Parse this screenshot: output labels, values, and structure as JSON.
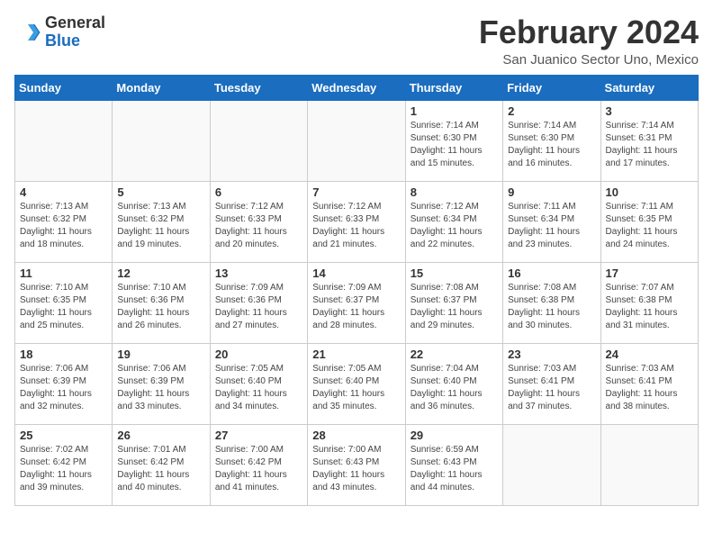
{
  "header": {
    "logo_general": "General",
    "logo_blue": "Blue",
    "month_title": "February 2024",
    "location": "San Juanico Sector Uno, Mexico"
  },
  "weekdays": [
    "Sunday",
    "Monday",
    "Tuesday",
    "Wednesday",
    "Thursday",
    "Friday",
    "Saturday"
  ],
  "weeks": [
    [
      {
        "day": "",
        "info": ""
      },
      {
        "day": "",
        "info": ""
      },
      {
        "day": "",
        "info": ""
      },
      {
        "day": "",
        "info": ""
      },
      {
        "day": "1",
        "info": "Sunrise: 7:14 AM\nSunset: 6:30 PM\nDaylight: 11 hours\nand 15 minutes."
      },
      {
        "day": "2",
        "info": "Sunrise: 7:14 AM\nSunset: 6:30 PM\nDaylight: 11 hours\nand 16 minutes."
      },
      {
        "day": "3",
        "info": "Sunrise: 7:14 AM\nSunset: 6:31 PM\nDaylight: 11 hours\nand 17 minutes."
      }
    ],
    [
      {
        "day": "4",
        "info": "Sunrise: 7:13 AM\nSunset: 6:32 PM\nDaylight: 11 hours\nand 18 minutes."
      },
      {
        "day": "5",
        "info": "Sunrise: 7:13 AM\nSunset: 6:32 PM\nDaylight: 11 hours\nand 19 minutes."
      },
      {
        "day": "6",
        "info": "Sunrise: 7:12 AM\nSunset: 6:33 PM\nDaylight: 11 hours\nand 20 minutes."
      },
      {
        "day": "7",
        "info": "Sunrise: 7:12 AM\nSunset: 6:33 PM\nDaylight: 11 hours\nand 21 minutes."
      },
      {
        "day": "8",
        "info": "Sunrise: 7:12 AM\nSunset: 6:34 PM\nDaylight: 11 hours\nand 22 minutes."
      },
      {
        "day": "9",
        "info": "Sunrise: 7:11 AM\nSunset: 6:34 PM\nDaylight: 11 hours\nand 23 minutes."
      },
      {
        "day": "10",
        "info": "Sunrise: 7:11 AM\nSunset: 6:35 PM\nDaylight: 11 hours\nand 24 minutes."
      }
    ],
    [
      {
        "day": "11",
        "info": "Sunrise: 7:10 AM\nSunset: 6:35 PM\nDaylight: 11 hours\nand 25 minutes."
      },
      {
        "day": "12",
        "info": "Sunrise: 7:10 AM\nSunset: 6:36 PM\nDaylight: 11 hours\nand 26 minutes."
      },
      {
        "day": "13",
        "info": "Sunrise: 7:09 AM\nSunset: 6:36 PM\nDaylight: 11 hours\nand 27 minutes."
      },
      {
        "day": "14",
        "info": "Sunrise: 7:09 AM\nSunset: 6:37 PM\nDaylight: 11 hours\nand 28 minutes."
      },
      {
        "day": "15",
        "info": "Sunrise: 7:08 AM\nSunset: 6:37 PM\nDaylight: 11 hours\nand 29 minutes."
      },
      {
        "day": "16",
        "info": "Sunrise: 7:08 AM\nSunset: 6:38 PM\nDaylight: 11 hours\nand 30 minutes."
      },
      {
        "day": "17",
        "info": "Sunrise: 7:07 AM\nSunset: 6:38 PM\nDaylight: 11 hours\nand 31 minutes."
      }
    ],
    [
      {
        "day": "18",
        "info": "Sunrise: 7:06 AM\nSunset: 6:39 PM\nDaylight: 11 hours\nand 32 minutes."
      },
      {
        "day": "19",
        "info": "Sunrise: 7:06 AM\nSunset: 6:39 PM\nDaylight: 11 hours\nand 33 minutes."
      },
      {
        "day": "20",
        "info": "Sunrise: 7:05 AM\nSunset: 6:40 PM\nDaylight: 11 hours\nand 34 minutes."
      },
      {
        "day": "21",
        "info": "Sunrise: 7:05 AM\nSunset: 6:40 PM\nDaylight: 11 hours\nand 35 minutes."
      },
      {
        "day": "22",
        "info": "Sunrise: 7:04 AM\nSunset: 6:40 PM\nDaylight: 11 hours\nand 36 minutes."
      },
      {
        "day": "23",
        "info": "Sunrise: 7:03 AM\nSunset: 6:41 PM\nDaylight: 11 hours\nand 37 minutes."
      },
      {
        "day": "24",
        "info": "Sunrise: 7:03 AM\nSunset: 6:41 PM\nDaylight: 11 hours\nand 38 minutes."
      }
    ],
    [
      {
        "day": "25",
        "info": "Sunrise: 7:02 AM\nSunset: 6:42 PM\nDaylight: 11 hours\nand 39 minutes."
      },
      {
        "day": "26",
        "info": "Sunrise: 7:01 AM\nSunset: 6:42 PM\nDaylight: 11 hours\nand 40 minutes."
      },
      {
        "day": "27",
        "info": "Sunrise: 7:00 AM\nSunset: 6:42 PM\nDaylight: 11 hours\nand 41 minutes."
      },
      {
        "day": "28",
        "info": "Sunrise: 7:00 AM\nSunset: 6:43 PM\nDaylight: 11 hours\nand 43 minutes."
      },
      {
        "day": "29",
        "info": "Sunrise: 6:59 AM\nSunset: 6:43 PM\nDaylight: 11 hours\nand 44 minutes."
      },
      {
        "day": "",
        "info": ""
      },
      {
        "day": "",
        "info": ""
      }
    ]
  ]
}
